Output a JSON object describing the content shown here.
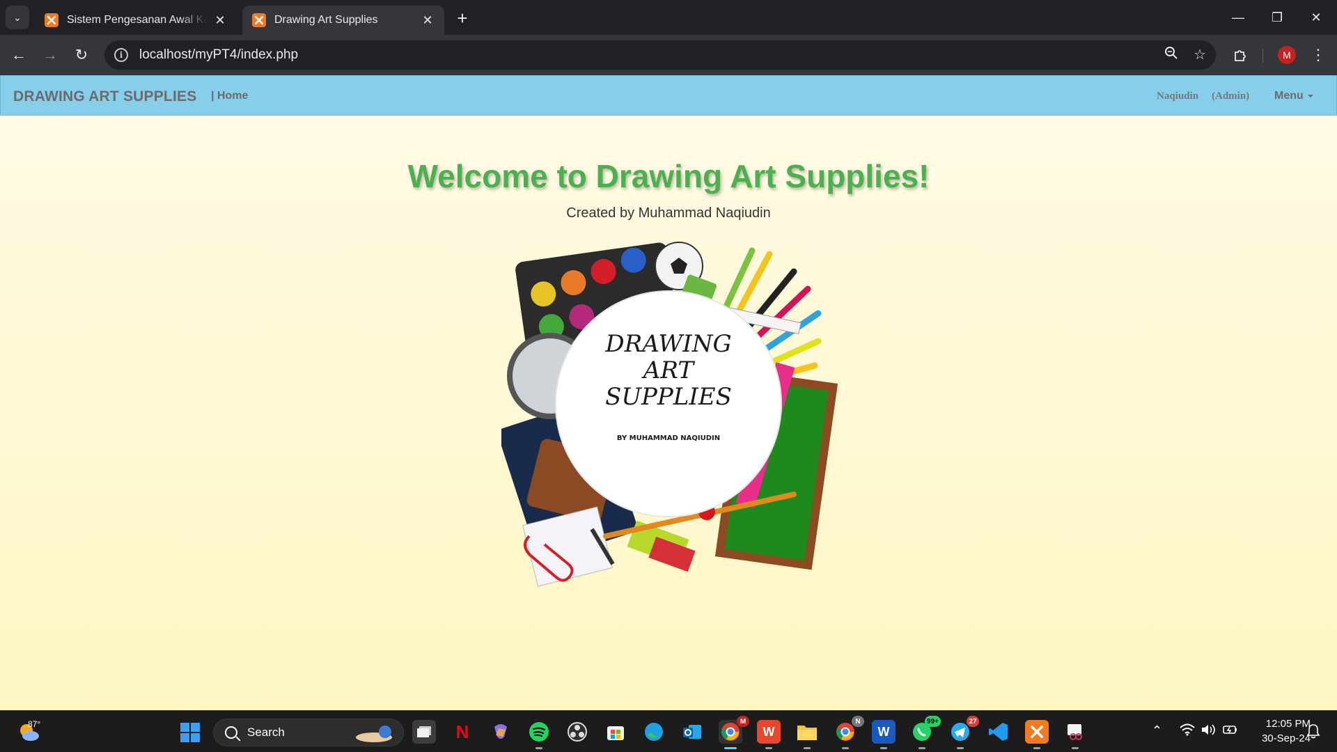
{
  "browser": {
    "tabs": [
      {
        "title": "Sistem Pengesanan Awal Kanser",
        "active": false
      },
      {
        "title": "Drawing Art Supplies",
        "active": true
      }
    ],
    "new_tab": "+",
    "url": "localhost/myPT4/index.php",
    "profile_initial": "M"
  },
  "site": {
    "brand": "DRAWING ART SUPPLIES",
    "nav_home": "| Home",
    "user_name": "Naqiudin",
    "user_role": "(Admin)",
    "menu_label": "Menu",
    "nav_color": "#87ceeb"
  },
  "main": {
    "welcome": "Welcome to Drawing Art Supplies!",
    "credit": "Created by Muhammad Naqiudin",
    "welcome_color": "#4caf50"
  },
  "logo": {
    "title_line1": "DRAWING",
    "title_line2": "ART",
    "title_line3": "SUPPLIES",
    "byline": "BY MUHAMMAD NAQIUDIN"
  },
  "taskbar": {
    "weather_temp": "87°",
    "search_placeholder": "Search",
    "time": "12:05 PM",
    "date": "30-Sep-24",
    "badges": {
      "chrome": "M",
      "chrome2": "N",
      "whatsapp": "99+",
      "telegram": "27"
    },
    "apps": [
      "file-explorer-gallery",
      "netflix",
      "copilot",
      "spotify",
      "obs-studio",
      "microsoft-store",
      "edge",
      "outlook",
      "chrome",
      "wps-office",
      "file-explorer",
      "chrome-profile",
      "word",
      "whatsapp",
      "telegram",
      "vs-code",
      "xampp",
      "snipping-tool"
    ]
  }
}
